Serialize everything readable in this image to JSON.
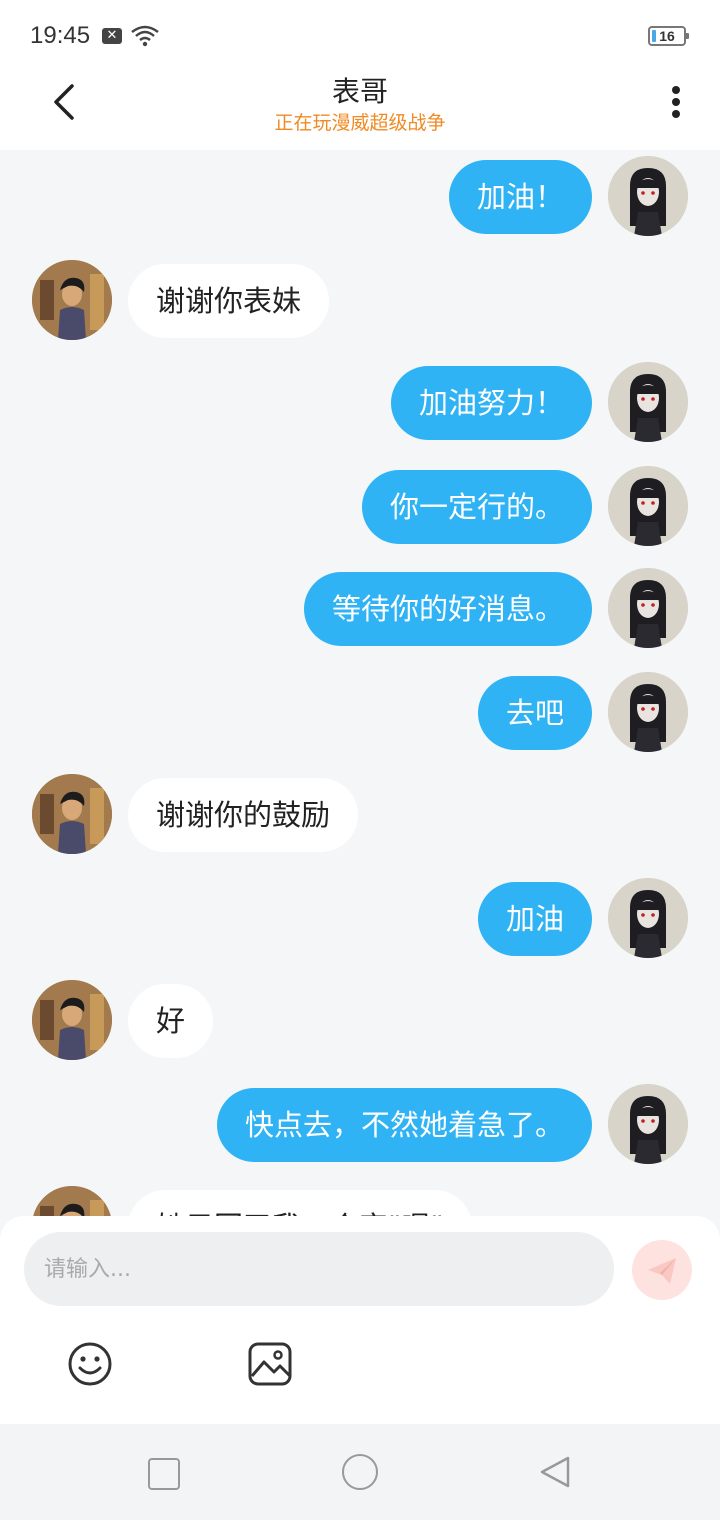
{
  "status_bar": {
    "time": "19:45",
    "notification_icon": "x-box-icon",
    "wifi_icon": "wifi-icon",
    "battery": "16"
  },
  "header": {
    "title": "表哥",
    "subtitle": "正在玩漫威超级战争",
    "back_icon": "chevron-left-icon",
    "more_icon": "more-vertical-icon"
  },
  "messages": [
    {
      "side": "out",
      "text": "加油！"
    },
    {
      "side": "in",
      "text": "谢谢你表妹"
    },
    {
      "side": "out",
      "text": "加油努力！"
    },
    {
      "side": "out",
      "text": "你一定行的。"
    },
    {
      "side": "out",
      "text": "等待你的好消息。"
    },
    {
      "side": "out",
      "text": "去吧"
    },
    {
      "side": "in",
      "text": "谢谢你的鼓励"
    },
    {
      "side": "out",
      "text": "加油"
    },
    {
      "side": "in",
      "text": "好"
    },
    {
      "side": "out",
      "text": "快点去，不然她着急了。"
    },
    {
      "side": "in",
      "text": "她只回了我一个字\"嗯\""
    }
  ],
  "input": {
    "placeholder": "请输入...",
    "value": "",
    "send_icon": "send-icon",
    "emoji_icon": "emoji-icon",
    "image_icon": "image-icon"
  },
  "colors": {
    "outgoing_bubble": "#2fb3f5",
    "incoming_bubble": "#ffffff",
    "subtitle": "#f08a24",
    "chat_background": "#f4f6f8",
    "send_button": "#fde2df"
  },
  "nav_bar": {
    "recent_icon": "square-icon",
    "home_icon": "circle-icon",
    "back_icon": "triangle-back-icon"
  }
}
